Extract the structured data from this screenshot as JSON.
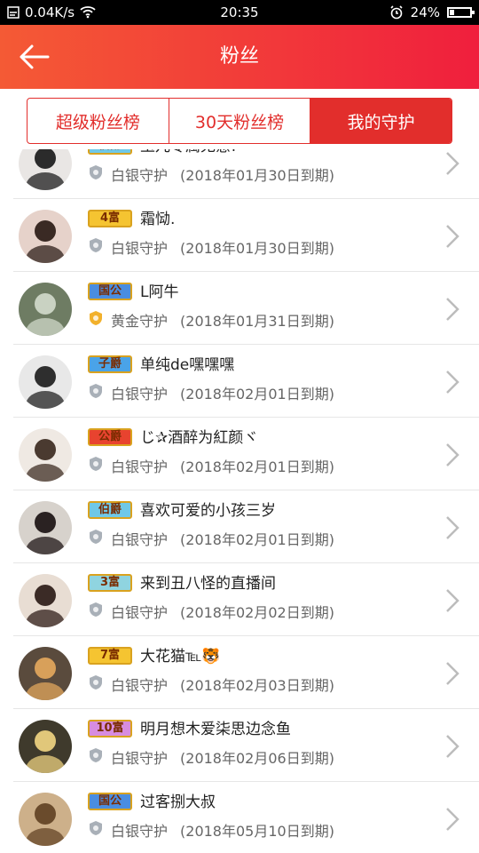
{
  "status": {
    "network_speed": "0.04K/s",
    "time": "20:35",
    "battery": "24%",
    "battery_level": 0.24
  },
  "header": {
    "title": "粉丝"
  },
  "tabs": [
    {
      "label": "超级粉丝榜"
    },
    {
      "label": "30天粉丝榜"
    },
    {
      "label": "我的守护",
      "active": true
    }
  ],
  "items": [
    {
      "badge": "伯爵",
      "badge_color": "#6fc8e8",
      "name": "玉儿专属无意!",
      "guard": "白银守护",
      "expire": "(2018年01月30日到期)",
      "guard_type": "silver"
    },
    {
      "badge": "4富",
      "badge_color": "#f5c431",
      "name": "霜恸.",
      "guard": "白银守护",
      "expire": "(2018年01月30日到期)",
      "guard_type": "silver"
    },
    {
      "badge": "国公",
      "badge_color": "#4a8de0",
      "name": "L阿牛",
      "guard": "黄金守护",
      "expire": "(2018年01月31日到期)",
      "guard_type": "gold"
    },
    {
      "badge": "子爵",
      "badge_color": "#4aa3e8",
      "name": "单纯de嘿嘿嘿",
      "guard": "白银守护",
      "expire": "(2018年02月01日到期)",
      "guard_type": "silver"
    },
    {
      "badge": "公爵",
      "badge_color": "#e8432f",
      "name": "じ✰酒醉为紅颜ヾ",
      "guard": "白银守护",
      "expire": "(2018年02月01日到期)",
      "guard_type": "silver"
    },
    {
      "badge": "伯爵",
      "badge_color": "#6fc8e8",
      "name": "喜欢可爱的小孩三岁",
      "guard": "白银守护",
      "expire": "(2018年02月01日到期)",
      "guard_type": "silver"
    },
    {
      "badge": "3富",
      "badge_color": "#8fd4e0",
      "name": "来到丑八怪的直播间",
      "guard": "白银守护",
      "expire": "(2018年02月02日到期)",
      "guard_type": "silver"
    },
    {
      "badge": "7富",
      "badge_color": "#f5c431",
      "name": "大花猫℡🐯",
      "guard": "白银守护",
      "expire": "(2018年02月03日到期)",
      "guard_type": "silver"
    },
    {
      "badge": "10富",
      "badge_color": "#d78ce0",
      "name": "明月想木爱柒思边念鱼",
      "guard": "白银守护",
      "expire": "(2018年02月06日到期)",
      "guard_type": "silver"
    },
    {
      "badge": "国公",
      "badge_color": "#4a8de0",
      "name": "过客捌大叔",
      "guard": "白银守护",
      "expire": "(2018年05月10日到期)",
      "guard_type": "silver"
    }
  ],
  "colors": {
    "accent": "#e22e2c",
    "header_start": "#f45a35",
    "header_end": "#f01f3d"
  }
}
